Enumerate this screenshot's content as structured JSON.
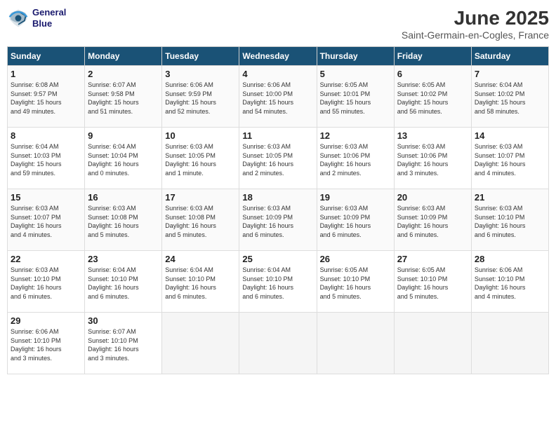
{
  "header": {
    "logo_line1": "General",
    "logo_line2": "Blue",
    "title": "June 2025",
    "subtitle": "Saint-Germain-en-Cogles, France"
  },
  "columns": [
    "Sunday",
    "Monday",
    "Tuesday",
    "Wednesday",
    "Thursday",
    "Friday",
    "Saturday"
  ],
  "rows": [
    [
      {
        "day": "1",
        "info": "Sunrise: 6:08 AM\nSunset: 9:57 PM\nDaylight: 15 hours\nand 49 minutes."
      },
      {
        "day": "2",
        "info": "Sunrise: 6:07 AM\nSunset: 9:58 PM\nDaylight: 15 hours\nand 51 minutes."
      },
      {
        "day": "3",
        "info": "Sunrise: 6:06 AM\nSunset: 9:59 PM\nDaylight: 15 hours\nand 52 minutes."
      },
      {
        "day": "4",
        "info": "Sunrise: 6:06 AM\nSunset: 10:00 PM\nDaylight: 15 hours\nand 54 minutes."
      },
      {
        "day": "5",
        "info": "Sunrise: 6:05 AM\nSunset: 10:01 PM\nDaylight: 15 hours\nand 55 minutes."
      },
      {
        "day": "6",
        "info": "Sunrise: 6:05 AM\nSunset: 10:02 PM\nDaylight: 15 hours\nand 56 minutes."
      },
      {
        "day": "7",
        "info": "Sunrise: 6:04 AM\nSunset: 10:02 PM\nDaylight: 15 hours\nand 58 minutes."
      }
    ],
    [
      {
        "day": "8",
        "info": "Sunrise: 6:04 AM\nSunset: 10:03 PM\nDaylight: 15 hours\nand 59 minutes."
      },
      {
        "day": "9",
        "info": "Sunrise: 6:04 AM\nSunset: 10:04 PM\nDaylight: 16 hours\nand 0 minutes."
      },
      {
        "day": "10",
        "info": "Sunrise: 6:03 AM\nSunset: 10:05 PM\nDaylight: 16 hours\nand 1 minute."
      },
      {
        "day": "11",
        "info": "Sunrise: 6:03 AM\nSunset: 10:05 PM\nDaylight: 16 hours\nand 2 minutes."
      },
      {
        "day": "12",
        "info": "Sunrise: 6:03 AM\nSunset: 10:06 PM\nDaylight: 16 hours\nand 2 minutes."
      },
      {
        "day": "13",
        "info": "Sunrise: 6:03 AM\nSunset: 10:06 PM\nDaylight: 16 hours\nand 3 minutes."
      },
      {
        "day": "14",
        "info": "Sunrise: 6:03 AM\nSunset: 10:07 PM\nDaylight: 16 hours\nand 4 minutes."
      }
    ],
    [
      {
        "day": "15",
        "info": "Sunrise: 6:03 AM\nSunset: 10:07 PM\nDaylight: 16 hours\nand 4 minutes."
      },
      {
        "day": "16",
        "info": "Sunrise: 6:03 AM\nSunset: 10:08 PM\nDaylight: 16 hours\nand 5 minutes."
      },
      {
        "day": "17",
        "info": "Sunrise: 6:03 AM\nSunset: 10:08 PM\nDaylight: 16 hours\nand 5 minutes."
      },
      {
        "day": "18",
        "info": "Sunrise: 6:03 AM\nSunset: 10:09 PM\nDaylight: 16 hours\nand 6 minutes."
      },
      {
        "day": "19",
        "info": "Sunrise: 6:03 AM\nSunset: 10:09 PM\nDaylight: 16 hours\nand 6 minutes."
      },
      {
        "day": "20",
        "info": "Sunrise: 6:03 AM\nSunset: 10:09 PM\nDaylight: 16 hours\nand 6 minutes."
      },
      {
        "day": "21",
        "info": "Sunrise: 6:03 AM\nSunset: 10:10 PM\nDaylight: 16 hours\nand 6 minutes."
      }
    ],
    [
      {
        "day": "22",
        "info": "Sunrise: 6:03 AM\nSunset: 10:10 PM\nDaylight: 16 hours\nand 6 minutes."
      },
      {
        "day": "23",
        "info": "Sunrise: 6:04 AM\nSunset: 10:10 PM\nDaylight: 16 hours\nand 6 minutes."
      },
      {
        "day": "24",
        "info": "Sunrise: 6:04 AM\nSunset: 10:10 PM\nDaylight: 16 hours\nand 6 minutes."
      },
      {
        "day": "25",
        "info": "Sunrise: 6:04 AM\nSunset: 10:10 PM\nDaylight: 16 hours\nand 6 minutes."
      },
      {
        "day": "26",
        "info": "Sunrise: 6:05 AM\nSunset: 10:10 PM\nDaylight: 16 hours\nand 5 minutes."
      },
      {
        "day": "27",
        "info": "Sunrise: 6:05 AM\nSunset: 10:10 PM\nDaylight: 16 hours\nand 5 minutes."
      },
      {
        "day": "28",
        "info": "Sunrise: 6:06 AM\nSunset: 10:10 PM\nDaylight: 16 hours\nand 4 minutes."
      }
    ],
    [
      {
        "day": "29",
        "info": "Sunrise: 6:06 AM\nSunset: 10:10 PM\nDaylight: 16 hours\nand 3 minutes."
      },
      {
        "day": "30",
        "info": "Sunrise: 6:07 AM\nSunset: 10:10 PM\nDaylight: 16 hours\nand 3 minutes."
      },
      null,
      null,
      null,
      null,
      null
    ]
  ]
}
